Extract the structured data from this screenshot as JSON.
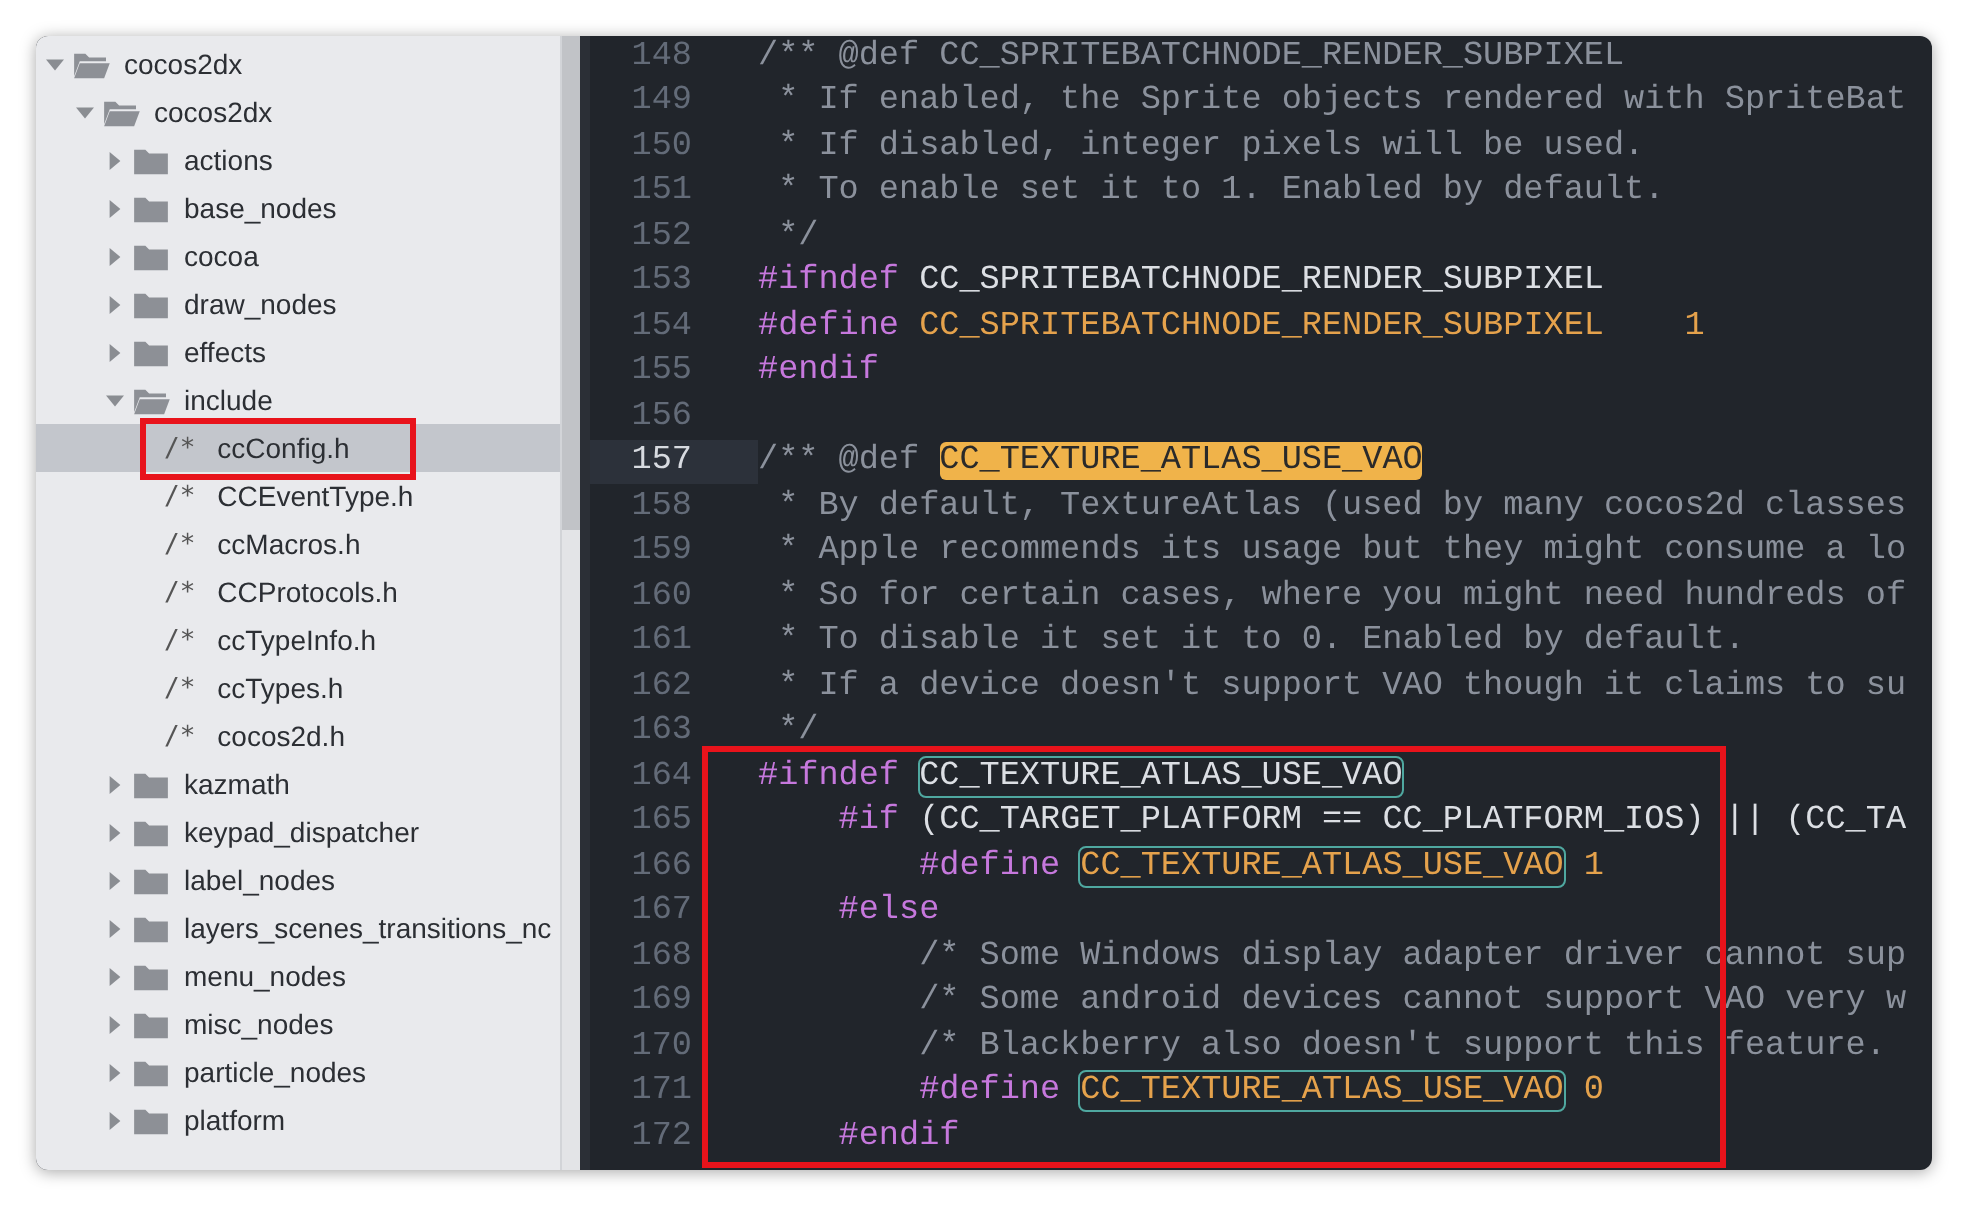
{
  "tree": [
    {
      "kind": "folder",
      "label": "cocos2dx",
      "expanded": true,
      "selected": false,
      "children": [
        {
          "kind": "folder",
          "label": "cocos2dx",
          "expanded": true,
          "selected": false,
          "children": [
            {
              "kind": "folder",
              "label": "actions",
              "expanded": false,
              "selected": false
            },
            {
              "kind": "folder",
              "label": "base_nodes",
              "expanded": false,
              "selected": false
            },
            {
              "kind": "folder",
              "label": "cocoa",
              "expanded": false,
              "selected": false
            },
            {
              "kind": "folder",
              "label": "draw_nodes",
              "expanded": false,
              "selected": false
            },
            {
              "kind": "folder",
              "label": "effects",
              "expanded": false,
              "selected": false
            },
            {
              "kind": "folder",
              "label": "include",
              "expanded": true,
              "selected": false,
              "children": [
                {
                  "kind": "file",
                  "glyph": "/*",
                  "label": "ccConfig.h",
                  "selected": true,
                  "marked": true
                },
                {
                  "kind": "file",
                  "glyph": "/*",
                  "label": "CCEventType.h",
                  "selected": false,
                  "marked": false
                },
                {
                  "kind": "file",
                  "glyph": "/*",
                  "label": "ccMacros.h",
                  "selected": false,
                  "marked": false
                },
                {
                  "kind": "file",
                  "glyph": "/*",
                  "label": "CCProtocols.h",
                  "selected": false,
                  "marked": false
                },
                {
                  "kind": "file",
                  "glyph": "/*",
                  "label": "ccTypeInfo.h",
                  "selected": false,
                  "marked": false
                },
                {
                  "kind": "file",
                  "glyph": "/*",
                  "label": "ccTypes.h",
                  "selected": false,
                  "marked": false
                },
                {
                  "kind": "file",
                  "glyph": "/*",
                  "label": "cocos2d.h",
                  "selected": false,
                  "marked": false
                }
              ]
            },
            {
              "kind": "folder",
              "label": "kazmath",
              "expanded": false,
              "selected": false
            },
            {
              "kind": "folder",
              "label": "keypad_dispatcher",
              "expanded": false,
              "selected": false
            },
            {
              "kind": "folder",
              "label": "label_nodes",
              "expanded": false,
              "selected": false
            },
            {
              "kind": "folder",
              "label": "layers_scenes_transitions_nc",
              "expanded": false,
              "selected": false
            },
            {
              "kind": "folder",
              "label": "menu_nodes",
              "expanded": false,
              "selected": false
            },
            {
              "kind": "folder",
              "label": "misc_nodes",
              "expanded": false,
              "selected": false
            },
            {
              "kind": "folder",
              "label": "particle_nodes",
              "expanded": false,
              "selected": false
            },
            {
              "kind": "folder",
              "label": "platform",
              "expanded": false,
              "selected": false
            }
          ]
        }
      ]
    }
  ],
  "code": [
    {
      "marked": false,
      "lines": [
        {
          "number": "148",
          "current": false,
          "tokens": [
            {
              "kind": "comment",
              "text": "/** @def CC_SPRITEBATCHNODE_RENDER_SUBPIXEL"
            }
          ]
        },
        {
          "number": "149",
          "current": false,
          "tokens": [
            {
              "kind": "comment",
              "text": " * If enabled, the Sprite objects rendered with SpriteBat"
            }
          ]
        },
        {
          "number": "150",
          "current": false,
          "tokens": [
            {
              "kind": "comment",
              "text": " * If disabled, integer pixels will be used."
            }
          ]
        },
        {
          "number": "151",
          "current": false,
          "tokens": [
            {
              "kind": "comment",
              "text": " * To enable set it to 1. Enabled by default."
            }
          ]
        },
        {
          "number": "152",
          "current": false,
          "tokens": [
            {
              "kind": "comment",
              "text": " */"
            }
          ]
        },
        {
          "number": "153",
          "current": false,
          "tokens": [
            {
              "kind": "directive",
              "text": "#ifndef"
            },
            {
              "kind": "name",
              "text": " CC_SPRITEBATCHNODE_RENDER_SUBPIXEL"
            }
          ]
        },
        {
          "number": "154",
          "current": false,
          "tokens": [
            {
              "kind": "directive",
              "text": "#define "
            },
            {
              "kind": "macro",
              "text": "CC_SPRITEBATCHNODE_RENDER_SUBPIXEL"
            },
            {
              "kind": "number",
              "text": "    1"
            }
          ]
        },
        {
          "number": "155",
          "current": false,
          "tokens": [
            {
              "kind": "directive",
              "text": "#endif"
            }
          ]
        },
        {
          "number": "156",
          "current": false
        },
        {
          "number": "157",
          "current": true,
          "tokens": [
            {
              "kind": "comment",
              "text": "/** @def "
            },
            {
              "kind": "found",
              "text": "CC_TEXTURE_ATLAS_USE_VAO"
            }
          ]
        },
        {
          "number": "158",
          "current": false,
          "tokens": [
            {
              "kind": "comment",
              "text": " * By default, TextureAtlas (used by many cocos2d classes"
            }
          ]
        },
        {
          "number": "159",
          "current": false,
          "tokens": [
            {
              "kind": "comment",
              "text": " * Apple recommends its usage but they might consume a lo"
            }
          ]
        },
        {
          "number": "160",
          "current": false,
          "tokens": [
            {
              "kind": "comment",
              "text": " * So for certain cases, where you might need hundreds of"
            }
          ]
        },
        {
          "number": "161",
          "current": false,
          "tokens": [
            {
              "kind": "comment",
              "text": " * To disable it set it to 0. Enabled by default."
            }
          ]
        },
        {
          "number": "162",
          "current": false,
          "tokens": [
            {
              "kind": "comment",
              "text": " * If a device doesn't support VAO though it claims to su"
            }
          ]
        },
        {
          "number": "163",
          "current": false,
          "tokens": [
            {
              "kind": "comment",
              "text": " */"
            }
          ]
        }
      ]
    },
    {
      "marked": true,
      "lines": [
        {
          "number": "164",
          "current": false,
          "tokens": [
            {
              "kind": "directive",
              "text": "#ifndef "
            },
            {
              "kind": "occurrence-name",
              "text": "CC_TEXTURE_ATLAS_USE_VAO"
            }
          ]
        },
        {
          "number": "165",
          "current": false,
          "tokens": [
            {
              "kind": "directive",
              "text": "    #if"
            },
            {
              "kind": "name",
              "text": " (CC_TARGET_PLATFORM == CC_PLATFORM_IOS) || (CC_TA"
            }
          ]
        },
        {
          "number": "166",
          "current": false,
          "tokens": [
            {
              "kind": "directive",
              "text": "        #define "
            },
            {
              "kind": "occurrence-macro",
              "text": "CC_TEXTURE_ATLAS_USE_VAO"
            },
            {
              "kind": "number",
              "text": " 1"
            }
          ]
        },
        {
          "number": "167",
          "current": false,
          "tokens": [
            {
              "kind": "directive",
              "text": "    #else"
            }
          ]
        },
        {
          "number": "168",
          "current": false,
          "tokens": [
            {
              "kind": "comment",
              "text": "        /* Some Windows display adapter driver cannot sup"
            }
          ]
        },
        {
          "number": "169",
          "current": false,
          "tokens": [
            {
              "kind": "comment",
              "text": "        /* Some android devices cannot support VAO very w"
            }
          ]
        },
        {
          "number": "170",
          "current": false,
          "tokens": [
            {
              "kind": "comment",
              "text": "        /* Blackberry also doesn't support this feature."
            }
          ]
        },
        {
          "number": "171",
          "current": false,
          "tokens": [
            {
              "kind": "directive",
              "text": "        #define "
            },
            {
              "kind": "occurrence-macro",
              "text": "CC_TEXTURE_ATLAS_USE_VAO"
            },
            {
              "kind": "number",
              "text": " 0"
            }
          ]
        },
        {
          "number": "172",
          "current": false,
          "tokens": [
            {
              "kind": "directive",
              "text": "    #endif"
            }
          ]
        }
      ]
    }
  ]
}
